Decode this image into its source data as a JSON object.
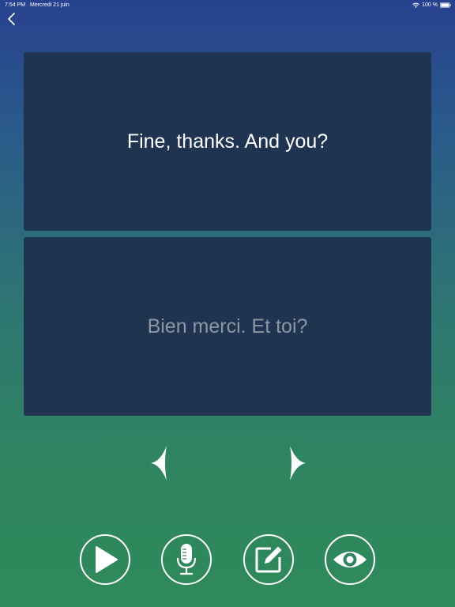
{
  "status_bar": {
    "time": "7:54 PM",
    "date": "Mercredi 21 juin",
    "battery": "100 %",
    "wifi_icon": "wifi-icon",
    "battery_icon": "battery-icon"
  },
  "nav": {
    "back_icon": "chevron-left-icon"
  },
  "flashcard": {
    "prompt_text": "Fine, thanks. And you?",
    "answer_text": "Bien merci. Et toi?"
  },
  "navigation_arrows": {
    "previous_icon": "triangle-left-icon",
    "next_icon": "triangle-right-icon"
  },
  "actions": [
    {
      "name": "play",
      "icon": "play-icon"
    },
    {
      "name": "record",
      "icon": "microphone-icon"
    },
    {
      "name": "edit",
      "icon": "edit-icon"
    },
    {
      "name": "reveal",
      "icon": "eye-icon"
    }
  ],
  "colors": {
    "gradient_top": "#27418f",
    "gradient_bottom": "#2f8a59",
    "card_background": "#1f3450",
    "answer_text": "#8d96a3"
  }
}
